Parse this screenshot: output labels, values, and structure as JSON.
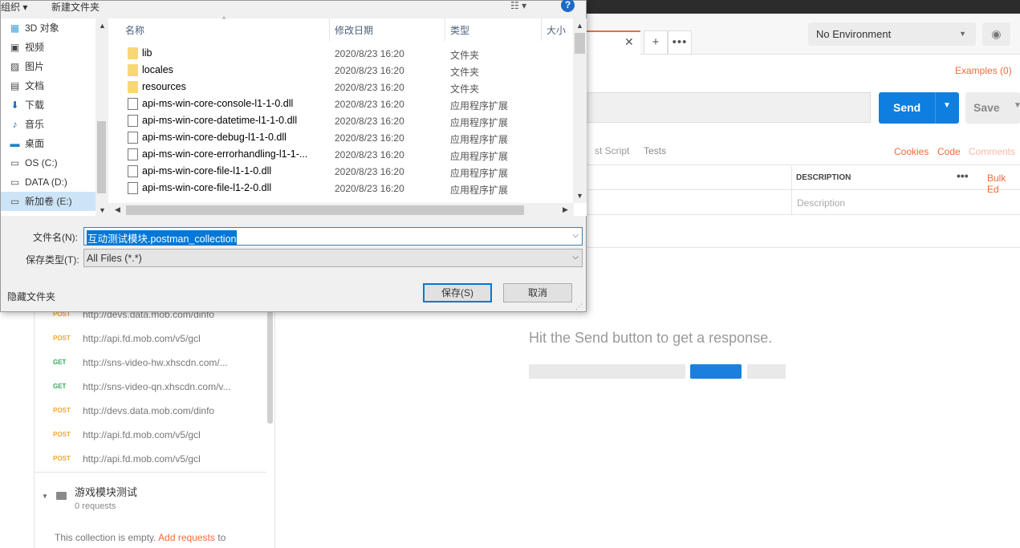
{
  "postman": {
    "environment": "No Environment",
    "examples": "Examples (0)",
    "send": "Send",
    "save": "Save",
    "subtabs": {
      "prereq": "st Script",
      "tests": "Tests"
    },
    "links": {
      "cookies": "Cookies",
      "code": "Code",
      "comments": "Comments"
    },
    "params": {
      "description_header": "DESCRIPTION",
      "bulk_edit": "Bulk Ed",
      "description_placeholder": "Description"
    },
    "response_hint": "Hit the Send button to get a response.",
    "history": [
      {
        "method": "POST",
        "url": "http://devs.data.mob.com/dinfo"
      },
      {
        "method": "POST",
        "url": "http://api.fd.mob.com/v5/gcl"
      },
      {
        "method": "GET",
        "url": "http://sns-video-hw.xhscdn.com/..."
      },
      {
        "method": "GET",
        "url": "http://sns-video-qn.xhscdn.com/v..."
      },
      {
        "method": "POST",
        "url": "http://devs.data.mob.com/dinfo"
      },
      {
        "method": "POST",
        "url": "http://api.fd.mob.com/v5/gcl"
      },
      {
        "method": "POST",
        "url": "http://api.fd.mob.com/v5/gcl"
      }
    ],
    "folder": {
      "name": "游戏模块测试",
      "count": "0 requests"
    },
    "empty_text": "This collection is empty.",
    "empty_link": "Add requests",
    "empty_suffix": "to"
  },
  "dialog": {
    "toolbar": {
      "organize": "组织 ▾",
      "new_folder": "新建文件夹",
      "view": "☷ ▾",
      "help": "?"
    },
    "nav": [
      {
        "label": "3D 对象",
        "icon": "3d-objects-icon",
        "glyph": "▦",
        "color": "#35a6d6"
      },
      {
        "label": "视频",
        "icon": "videos-icon",
        "glyph": "▣",
        "color": "#444"
      },
      {
        "label": "图片",
        "icon": "pictures-icon",
        "glyph": "▨",
        "color": "#444"
      },
      {
        "label": "文档",
        "icon": "documents-icon",
        "glyph": "▤",
        "color": "#444"
      },
      {
        "label": "下载",
        "icon": "downloads-icon",
        "glyph": "⬇",
        "color": "#1b6ac6"
      },
      {
        "label": "音乐",
        "icon": "music-icon",
        "glyph": "♪",
        "color": "#1b6ac6"
      },
      {
        "label": "桌面",
        "icon": "desktop-icon",
        "glyph": "▬",
        "color": "#1b82c6"
      },
      {
        "label": "OS (C:)",
        "icon": "drive-icon",
        "glyph": "▭",
        "color": "#555"
      },
      {
        "label": "DATA (D:)",
        "icon": "drive-icon",
        "glyph": "▭",
        "color": "#555"
      },
      {
        "label": "新加卷 (E:)",
        "icon": "drive-icon",
        "glyph": "▭",
        "color": "#555"
      }
    ],
    "columns": {
      "name": "名称",
      "date": "修改日期",
      "type": "类型",
      "size": "大小"
    },
    "files": [
      {
        "name": "lib",
        "date": "2020/8/23 16:20",
        "type": "文件夹",
        "kind": "folder"
      },
      {
        "name": "locales",
        "date": "2020/8/23 16:20",
        "type": "文件夹",
        "kind": "folder"
      },
      {
        "name": "resources",
        "date": "2020/8/23 16:20",
        "type": "文件夹",
        "kind": "folder"
      },
      {
        "name": "api-ms-win-core-console-l1-1-0.dll",
        "date": "2020/8/23 16:20",
        "type": "应用程序扩展",
        "kind": "file"
      },
      {
        "name": "api-ms-win-core-datetime-l1-1-0.dll",
        "date": "2020/8/23 16:20",
        "type": "应用程序扩展",
        "kind": "file"
      },
      {
        "name": "api-ms-win-core-debug-l1-1-0.dll",
        "date": "2020/8/23 16:20",
        "type": "应用程序扩展",
        "kind": "file"
      },
      {
        "name": "api-ms-win-core-errorhandling-l1-1-...",
        "date": "2020/8/23 16:20",
        "type": "应用程序扩展",
        "kind": "file"
      },
      {
        "name": "api-ms-win-core-file-l1-1-0.dll",
        "date": "2020/8/23 16:20",
        "type": "应用程序扩展",
        "kind": "file"
      },
      {
        "name": "api-ms-win-core-file-l1-2-0.dll",
        "date": "2020/8/23 16:20",
        "type": "应用程序扩展",
        "kind": "file"
      }
    ],
    "filename_label": "文件名(N):",
    "filename_value": "互动测试模块.postman_collection",
    "filetype_label": "保存类型(T):",
    "filetype_value": "All Files (*.*)",
    "hide_folders": "隐藏文件夹",
    "save_button": "保存(S)",
    "cancel_button": "取消"
  }
}
